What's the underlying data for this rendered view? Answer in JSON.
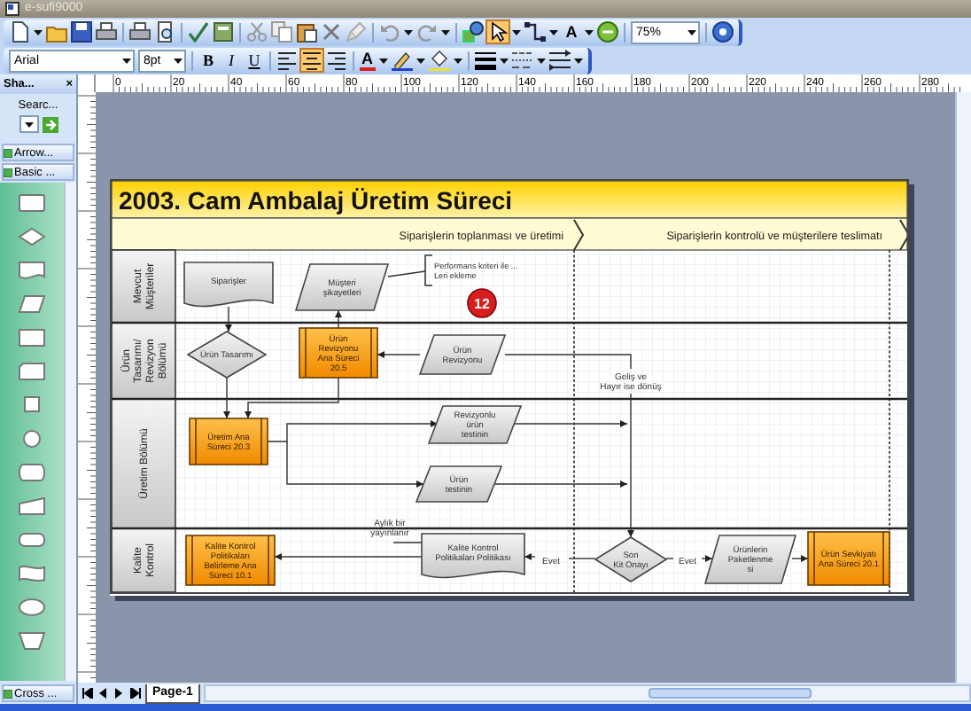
{
  "window": {
    "title": "e-sufi9000"
  },
  "standard_toolbar": {
    "pointer_tool": {
      "selected": true
    },
    "text_tool": "A",
    "zoom": "75%"
  },
  "formatting_toolbar": {
    "font": "Arial",
    "size": "8pt",
    "bold": "B",
    "italic": "I",
    "underline": "U",
    "font_color": "A",
    "alignments": [
      {
        "selected": false
      },
      {
        "selected": true
      },
      {
        "selected": false
      }
    ]
  },
  "shapes_panel": {
    "title": "Sha...",
    "close": "×",
    "search_label": "Searc...",
    "stencils": [
      {
        "label": "Arrow..."
      },
      {
        "label": "Basic ..."
      }
    ],
    "footer_stencil": "Cross ..."
  },
  "ruler": {
    "labels": [
      "0",
      "20",
      "40",
      "60",
      "80",
      "100",
      "120",
      "140",
      "160",
      "180",
      "200",
      "220",
      "240",
      "260",
      "280"
    ]
  },
  "diagram": {
    "title": "2003. Cam Ambalaj Üretim Süreci",
    "phases": [
      "Siparişlerin toplanması ve üretimi",
      "Siparişlerin kontrolü ve müşterilere teslimatı"
    ],
    "lanes": [
      {
        "lines": [
          "Mevcut",
          "Müşteriler"
        ]
      },
      {
        "lines": [
          "Ürün",
          "Tasarımı/",
          "Revizyon",
          "Bölümü"
        ]
      },
      {
        "lines": [
          "Üretim Bölümü"
        ]
      },
      {
        "lines": [
          "Kalite",
          "Kontrol"
        ]
      }
    ],
    "shapes": [
      {
        "kind": "document",
        "lines": [
          "Siparişler"
        ]
      },
      {
        "kind": "data",
        "lines": [
          "Müşteri",
          "şikayetleri"
        ]
      },
      {
        "kind": "callout",
        "lines": [
          "Performans kriteri ile ...",
          "Leri ekleme"
        ]
      },
      {
        "kind": "badge",
        "lines": [
          "12"
        ]
      },
      {
        "kind": "decision",
        "lines": [
          "Ürün Tasarımı"
        ]
      },
      {
        "kind": "subprocess",
        "lines": [
          "Ürün",
          "Revizyonu",
          "Ana Süreci",
          "20.5"
        ]
      },
      {
        "kind": "data",
        "lines": [
          "Ürün",
          "Revizyonu"
        ]
      },
      {
        "kind": "label",
        "lines": [
          "Geliş ve",
          "Hayır ise dönüş"
        ]
      },
      {
        "kind": "subprocess",
        "lines": [
          "Üretim Ana",
          "Süreci 20.3"
        ]
      },
      {
        "kind": "data",
        "lines": [
          "Revizyonlu",
          "ürün",
          "testinin"
        ]
      },
      {
        "kind": "data",
        "lines": [
          "Ürün",
          "testinin"
        ]
      },
      {
        "kind": "subprocess",
        "lines": [
          "Kalite Kontrol",
          "Politikaları",
          "Belirleme Ana",
          "Süreci 10.1"
        ]
      },
      {
        "kind": "label",
        "lines": [
          "Aylık bir",
          "yayınlanır"
        ]
      },
      {
        "kind": "document",
        "lines": [
          "Kalite Kontrol",
          "Politikaları Politikası"
        ]
      },
      {
        "kind": "label",
        "lines": [
          "Evet"
        ]
      },
      {
        "kind": "decision",
        "lines": [
          "Son",
          "Kit Onayı"
        ]
      },
      {
        "kind": "label",
        "lines": [
          "Evet"
        ]
      },
      {
        "kind": "data",
        "lines": [
          "Ürünlerin",
          "Paketlenme",
          "si"
        ]
      },
      {
        "kind": "subprocess",
        "lines": [
          "Ürün Sevkiyatı",
          "Ana Süreci 20.1"
        ]
      }
    ]
  },
  "page_tabs": [
    {
      "label": "Page-1",
      "selected": true
    }
  ]
}
